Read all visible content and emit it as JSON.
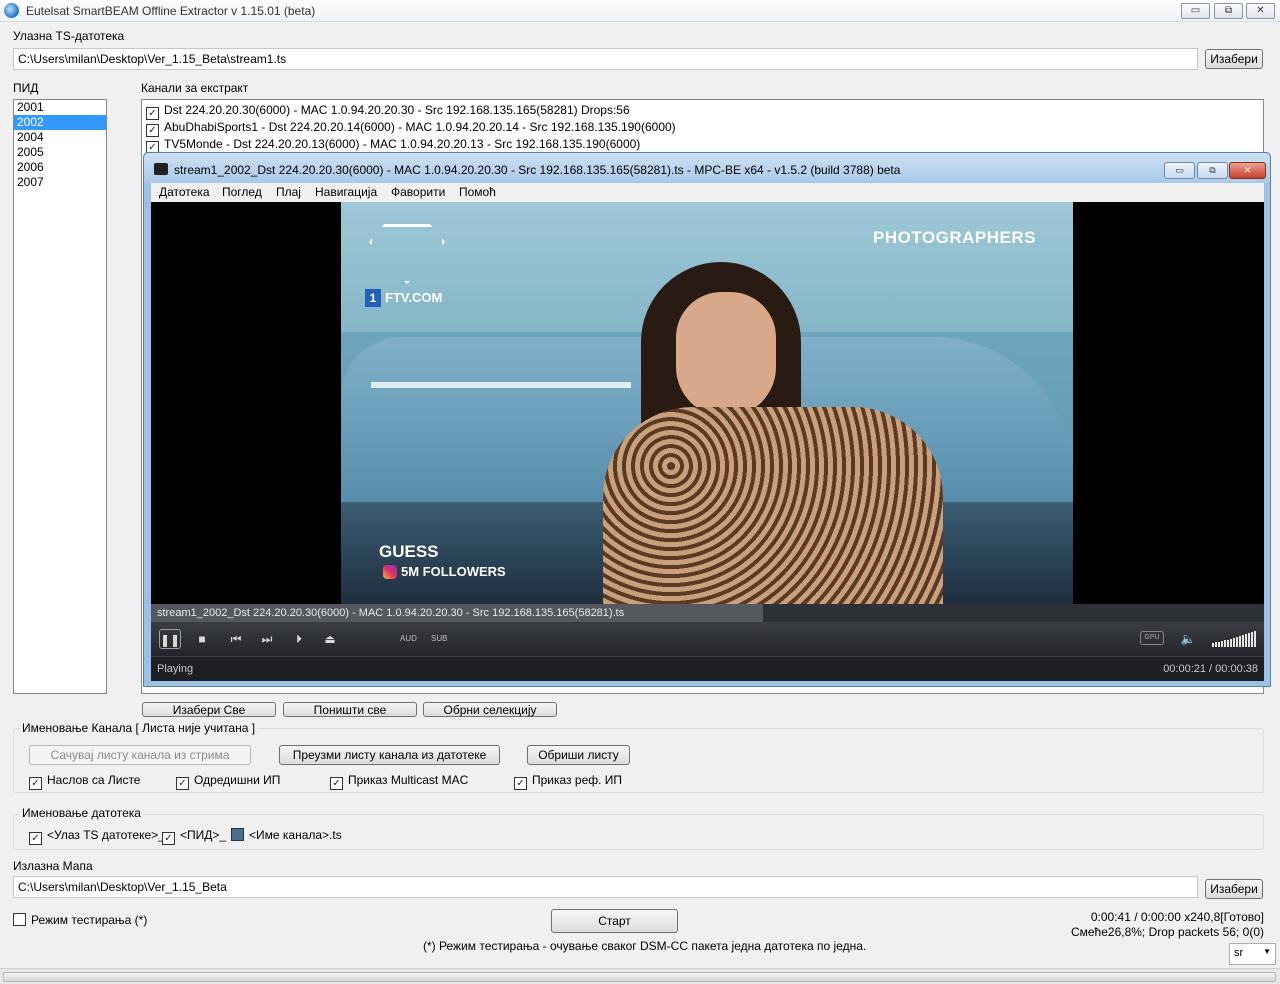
{
  "window": {
    "title": "Eutelsat SmartBEAM Offline Extractor v 1.15.01 (beta)",
    "min": "▭",
    "max": "⧉",
    "close": "✕"
  },
  "input": {
    "label": "Улазна TS-датотека",
    "path": "C:\\Users\\milan\\Desktop\\Ver_1.15_Beta\\stream1.ts",
    "browse": "Изабери"
  },
  "pid": {
    "label": "ПИД",
    "items": [
      "2001",
      "2002",
      "2004",
      "2005",
      "2006",
      "2007"
    ],
    "selected": "2002"
  },
  "channels": {
    "label": "Канали за екстракт",
    "items": [
      {
        "text": "Dst 224.20.20.30(6000) - MAC 1.0.94.20.20.30 - Src 192.168.135.165(58281) Drops:56",
        "checked": true
      },
      {
        "text": "AbuDhabiSports1 - Dst 224.20.20.14(6000) - MAC 1.0.94.20.20.14 - Src 192.168.135.190(6000)",
        "checked": true
      },
      {
        "text": "TV5Monde - Dst 224.20.20.13(6000) - MAC 1.0.94.20.20.13 - Src 192.168.135.190(6000)",
        "checked": true
      }
    ]
  },
  "player": {
    "title": "stream1_2002_Dst 224.20.20.30(6000) - MAC 1.0.94.20.20.30 - Src 192.168.135.165(58281).ts - MPC-BE x64 - v1.5.2 (build 3788) beta",
    "menu": [
      "Датотека",
      "Поглед",
      "Плај",
      "Навигација",
      "Фаворити",
      "Помоћ"
    ],
    "video": {
      "logo_text": "FTV.COM",
      "badge": "1",
      "overlay_top": "PHOTOGRAPHERS",
      "overlay_brand": "GUESS",
      "overlay_followers": "5M FOLLOWERS"
    },
    "seek_label": "stream1_2002_Dst 224.20.20.30(6000) - MAC 1.0.94.20.20.30 - Src 192.168.135.165(58281).ts",
    "seek_progress": 0.55,
    "aud": "AUD",
    "sub": "SUB",
    "gpu": "GPU",
    "status": "Playing",
    "time": "00:00:21 / 00:00:38"
  },
  "selection_buttons": {
    "select_all": "Изабери Све",
    "clear_all": "Поништи све",
    "invert": "Обрни селекцију"
  },
  "channel_naming": {
    "legend": "Именовање Канала [ Листа није учитана ]",
    "save_list": "Сачувај листу канала из стрима",
    "load_list": "Преузми листу канала из датотеке",
    "delete_list": "Обриши листу",
    "options": [
      {
        "label": "Наслов са Листе",
        "checked": true
      },
      {
        "label": "Одредишни ИП",
        "checked": true
      },
      {
        "label": "Приказ Multicast MAC",
        "checked": true
      },
      {
        "label": "Приказ реф. ИП",
        "checked": true
      }
    ]
  },
  "file_naming": {
    "legend": "Именовање датотека",
    "options": [
      {
        "label": "<Улаз TS датотеке>_",
        "checked": true
      },
      {
        "label": "<ПИД>_",
        "checked": true
      },
      {
        "label": "<Име канала>.ts",
        "checked": false
      }
    ]
  },
  "output": {
    "label": "Излазна Мапа",
    "path": "C:\\Users\\milan\\Desktop\\Ver_1.15_Beta",
    "browse": "Изабери"
  },
  "test_mode": {
    "label": "Режим тестирања (*)",
    "checked": false
  },
  "start_button": "Старт",
  "note": "(*) Режим тестирања - очување сваког DSM-CC пакета једна датотека по једна.",
  "progress_line1": "0:00:41 / 0:00:00  x240,8[Готово]",
  "progress_line2": "Смеће26,8%; Drop packets 56; 0(0)",
  "language": "sr"
}
